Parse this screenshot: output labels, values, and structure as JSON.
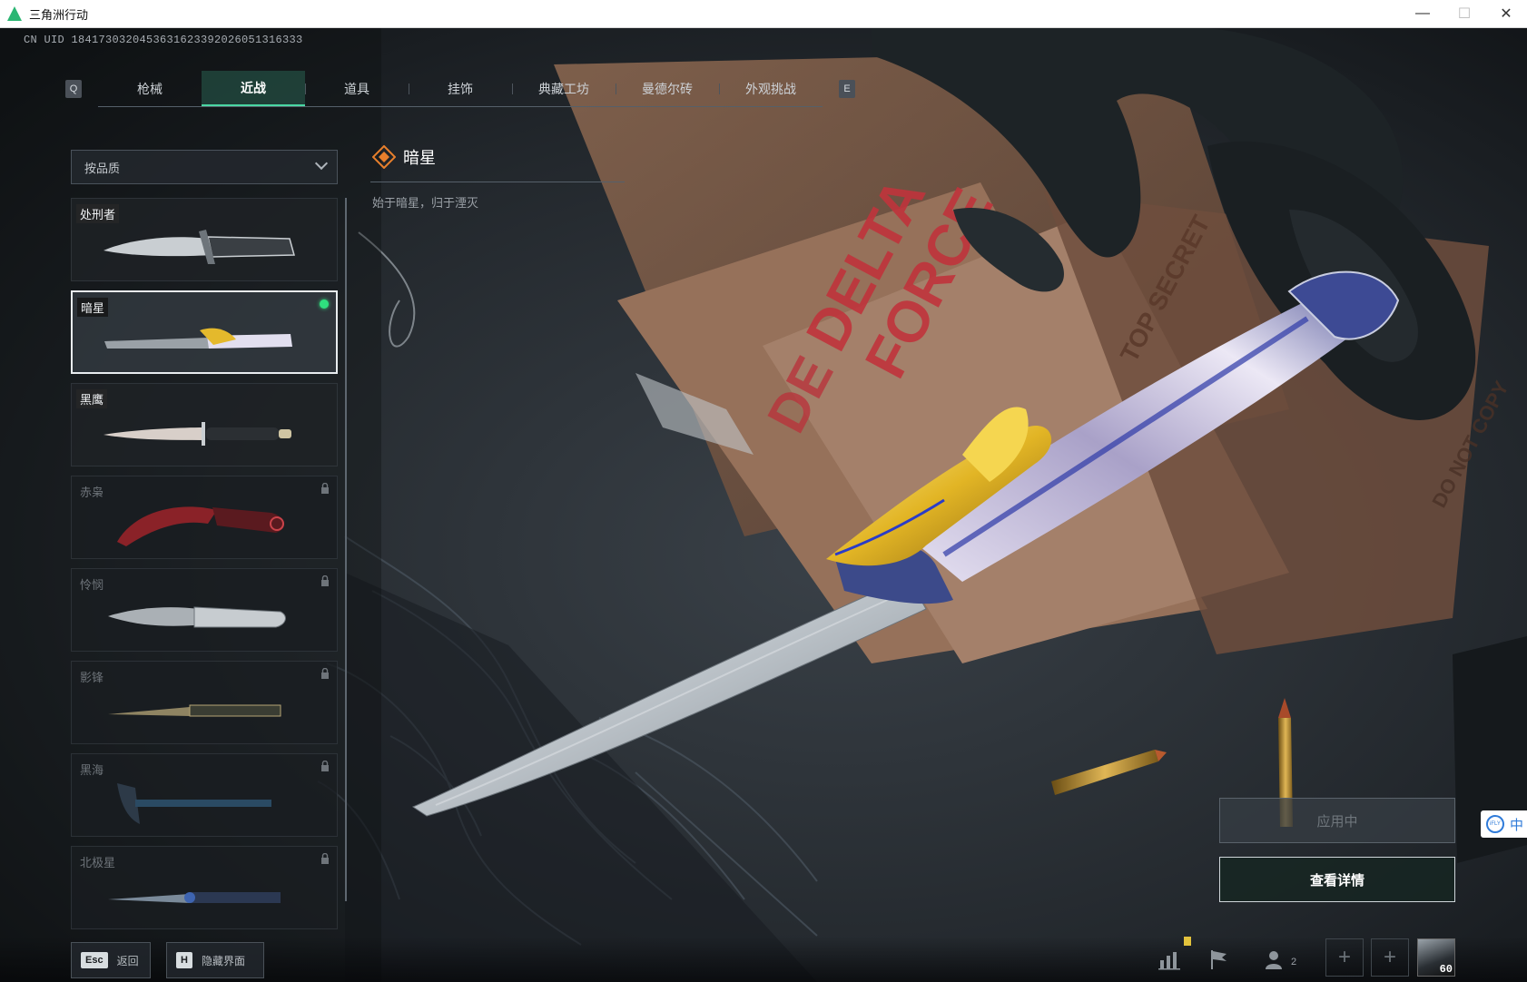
{
  "window": {
    "title": "三角洲行动",
    "minimize_glyph": "—",
    "maximize_glyph": "☐",
    "close_glyph": "✕"
  },
  "uid": "CN UID 1841730320453631623392026051316333",
  "tabs": {
    "left_key": "Q",
    "right_key": "E",
    "items": [
      {
        "label": "枪械",
        "active": false
      },
      {
        "label": "近战",
        "active": true
      },
      {
        "label": "道具",
        "active": false
      },
      {
        "label": "挂饰",
        "active": false
      },
      {
        "label": "典藏工坊",
        "active": false
      },
      {
        "label": "曼德尔砖",
        "active": false
      },
      {
        "label": "外观挑战",
        "active": false
      }
    ]
  },
  "filter": {
    "selected": "按品质"
  },
  "items": [
    {
      "name": "处刑者",
      "state": "unlocked"
    },
    {
      "name": "暗星",
      "state": "selected"
    },
    {
      "name": "黑鹰",
      "state": "unlocked"
    },
    {
      "name": "赤枭",
      "state": "locked"
    },
    {
      "name": "怜悯",
      "state": "locked"
    },
    {
      "name": "影锋",
      "state": "locked"
    },
    {
      "name": "黑海",
      "state": "locked"
    },
    {
      "name": "北极星",
      "state": "locked"
    }
  ],
  "detail": {
    "title": "暗星",
    "description": "始于暗星，归于湮灭"
  },
  "actions": {
    "applying_label": "应用中",
    "details_label": "查看详情"
  },
  "bottom": {
    "esc_key": "Esc",
    "esc_label": "返回",
    "h_key": "H",
    "h_label": "隐藏界面",
    "friend_count": "2",
    "plus_glyph": "+",
    "player_level": "60"
  },
  "ime": {
    "logo": "iFLY",
    "mode": "中"
  },
  "colors": {
    "accent": "#4ad7a3",
    "equipped": "#2fe07e",
    "rarity_orange": "#e77f2c",
    "titlebar_bg": "#ffffff"
  }
}
